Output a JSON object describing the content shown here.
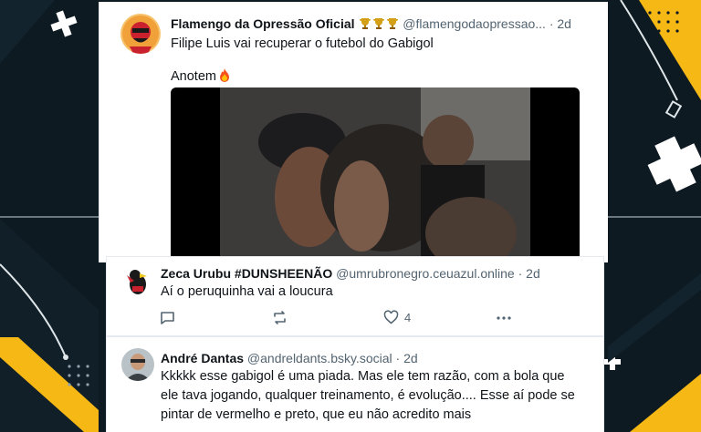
{
  "colors": {
    "background": "#0d1a22",
    "accent_yellow": "#f5b815",
    "card": "#ffffff",
    "text": "#0f1419",
    "muted": "#536471"
  },
  "posts": [
    {
      "author": "Flamengo da Opressão Oficial",
      "badges": [
        "trophy-icon",
        "trophy-icon",
        "trophy-icon"
      ],
      "handle": "@flamengodaopressao...",
      "separator": "·",
      "time": "2d",
      "line1": "Filipe Luis vai recuperar o futebol do Gabigol",
      "line2": "Anotem",
      "line2_emoji": "fire-icon",
      "media": "video-thumbnail"
    },
    {
      "author": "Zeca Urubu #DUNSHEENÃO",
      "handle": "@umrubronegro.ceuazul.online",
      "separator": "·",
      "time": "2d",
      "text": "Aí o peruquinha vai a loucura",
      "actions": {
        "reply_icon": "reply-icon",
        "repost_icon": "repost-icon",
        "like_icon": "heart-icon",
        "like_count": "4",
        "more_icon": "more-icon"
      }
    },
    {
      "author": "André Dantas",
      "handle": "@andreldants.bsky.social",
      "separator": "·",
      "time": "2d",
      "line1": "Kkkkk esse gabigol é uma piada. Mas ele tem razão, com a bola que",
      "line2": "ele tava jogando, qualquer treinamento, é evolução.... Esse aí pode se",
      "line3": "pintar de vermelho e preto, que eu não acredito mais"
    }
  ]
}
